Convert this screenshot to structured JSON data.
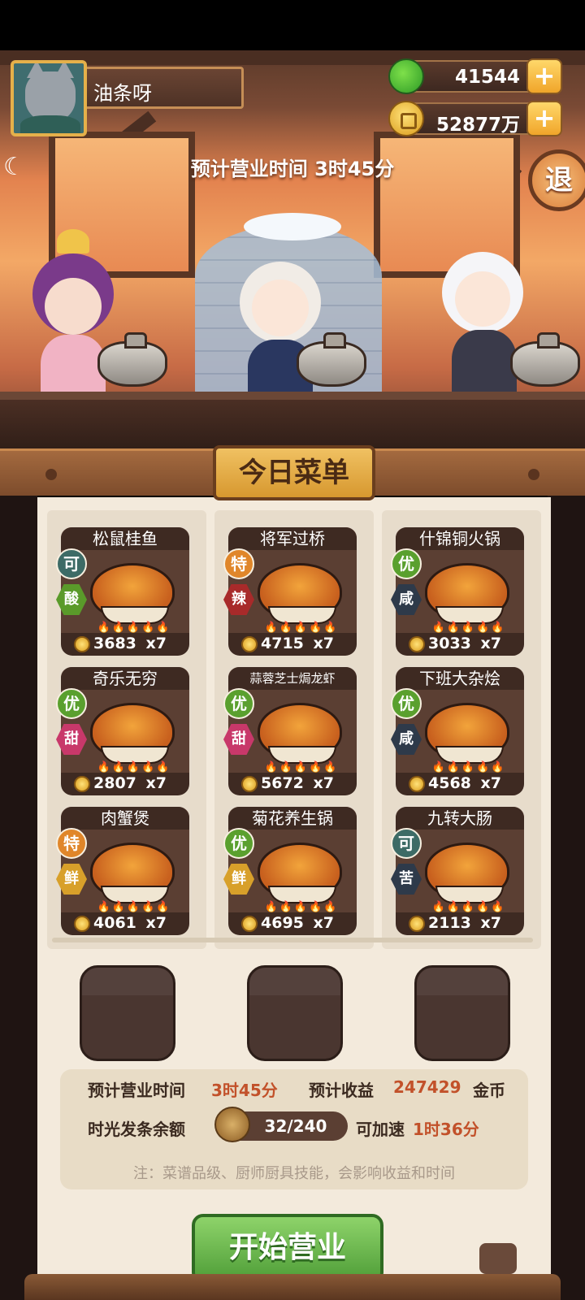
{
  "player": {
    "name": "油条呀"
  },
  "resources": {
    "apples": "41544",
    "coins": "52877万"
  },
  "header": {
    "estimated_time": "预计营业时间  3时45分",
    "exit_label": "退"
  },
  "menu": {
    "title": "今日菜单",
    "dishes": [
      {
        "name": "松鼠桂鱼",
        "quality": "可",
        "flavor": "酸",
        "price": "3683",
        "qty": "x7"
      },
      {
        "name": "将军过桥",
        "quality": "特",
        "flavor": "辣",
        "price": "4715",
        "qty": "x7"
      },
      {
        "name": "什锦铜火锅",
        "quality": "优",
        "flavor": "咸",
        "price": "3033",
        "qty": "x7"
      },
      {
        "name": "奇乐无穷",
        "quality": "优",
        "flavor": "甜",
        "price": "2807",
        "qty": "x7"
      },
      {
        "name": "蒜蓉芝士焗龙虾",
        "quality": "优",
        "flavor": "甜",
        "price": "5672",
        "qty": "x7"
      },
      {
        "name": "下班大杂烩",
        "quality": "优",
        "flavor": "咸",
        "price": "4568",
        "qty": "x7"
      },
      {
        "name": "肉蟹煲",
        "quality": "特",
        "flavor": "鲜",
        "price": "4061",
        "qty": "x7"
      },
      {
        "name": "菊花养生锅",
        "quality": "优",
        "flavor": "鲜",
        "price": "4695",
        "qty": "x7"
      },
      {
        "name": "九转大肠",
        "quality": "可",
        "flavor": "苦",
        "price": "2113",
        "qty": "x7"
      }
    ]
  },
  "summary": {
    "time_label": "预计营业时间",
    "time_value": "3时45分",
    "income_label": "预计收益",
    "income_value": "247429",
    "income_unit": "金币",
    "balance_label": "时光发条余额",
    "balance_value": "32/240",
    "speedup_label": "可加速",
    "speedup_value": "1时36分",
    "note": "注：菜谱品级、厨师厨具技能，会影响收益和时间"
  },
  "start_button": "开始营业",
  "colors": {
    "accent_orange": "#c2512a",
    "start_green": "#4f9e38",
    "panel_paper": "#f3eadc"
  }
}
